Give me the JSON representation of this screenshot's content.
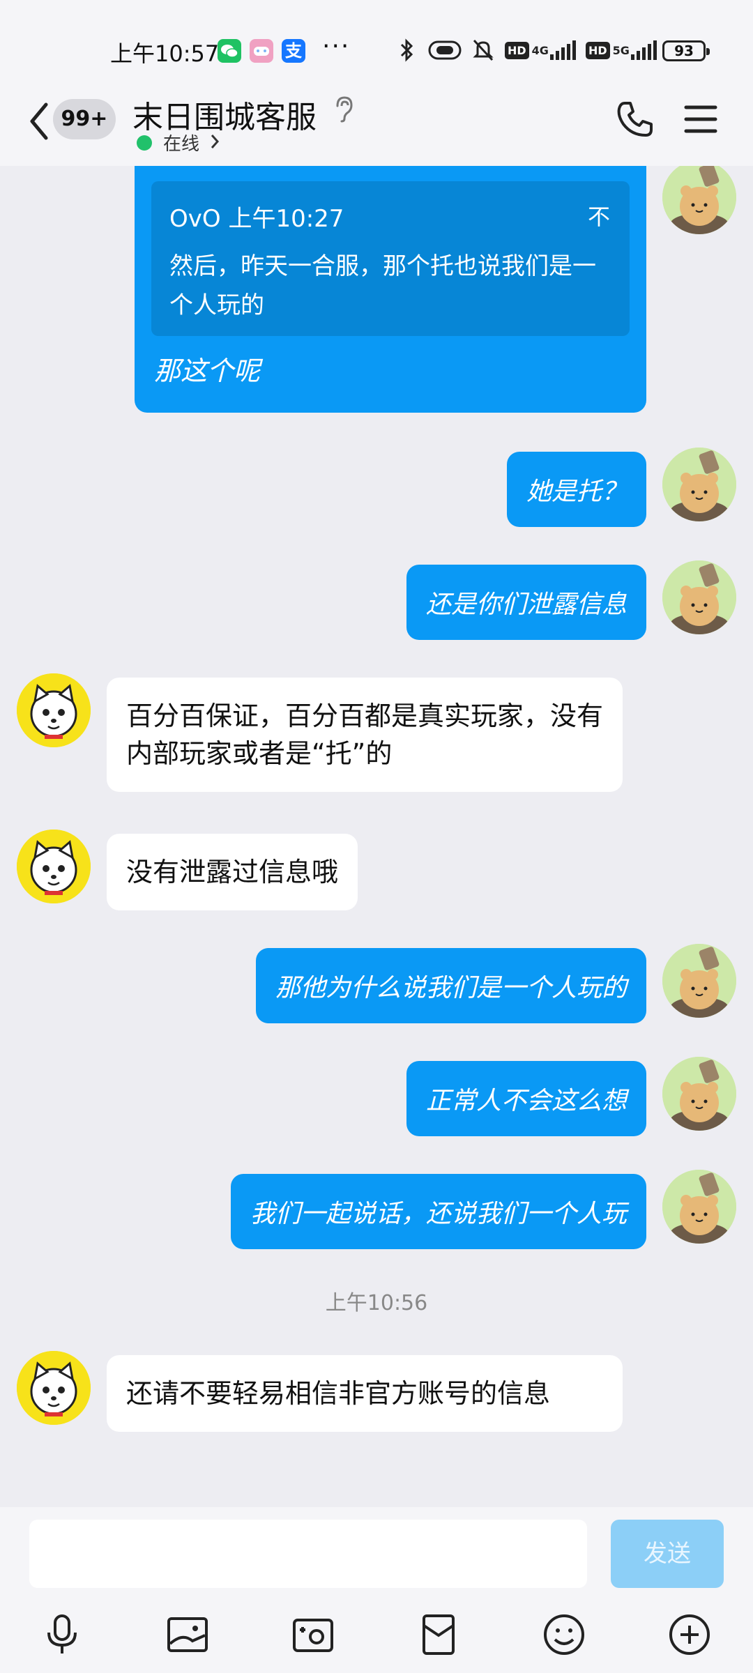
{
  "status_bar": {
    "time": "上午10:57",
    "more": "···",
    "hd1": "HD",
    "net1": "4G",
    "hd2": "HD",
    "net2": "5G",
    "battery": "93",
    "apps": [
      "wechat-icon",
      "game-icon",
      "alipay-icon"
    ]
  },
  "header": {
    "back_badge": "99+",
    "title": "末日围城客服",
    "status": "在线",
    "colors": {
      "online": "#21c16b",
      "bubble_out": "#0a99f5"
    }
  },
  "chat": {
    "quoted": {
      "author_time": "OvO 上午10:27",
      "flag": "不",
      "text": "然后，昨天一合服，那个托也说我们是一个人玩的",
      "reply": "那这个呢"
    },
    "messages": [
      {
        "from": "me",
        "text": "她是托？"
      },
      {
        "from": "me",
        "text": "还是你们泄露信息"
      },
      {
        "from": "cs",
        "text": "百分百保证，百分百都是真实玩家，没有内部玩家或者是“托”的"
      },
      {
        "from": "cs",
        "text": "没有泄露过信息哦"
      },
      {
        "from": "me",
        "text": "那他为什么说我们是一个人玩的"
      },
      {
        "from": "me",
        "text": "正常人不会这么想"
      },
      {
        "from": "me",
        "text": "我们一起说话，还说我们一个人玩"
      },
      {
        "from": "cs",
        "text": "还请不要轻易相信非官方账号的信息"
      }
    ],
    "timestamp": "上午10:56"
  },
  "input": {
    "placeholder": "",
    "send_label": "发送",
    "tools": [
      "microphone-icon",
      "image-icon",
      "camera-icon",
      "red-packet-icon",
      "emoji-icon",
      "plus-icon"
    ]
  }
}
